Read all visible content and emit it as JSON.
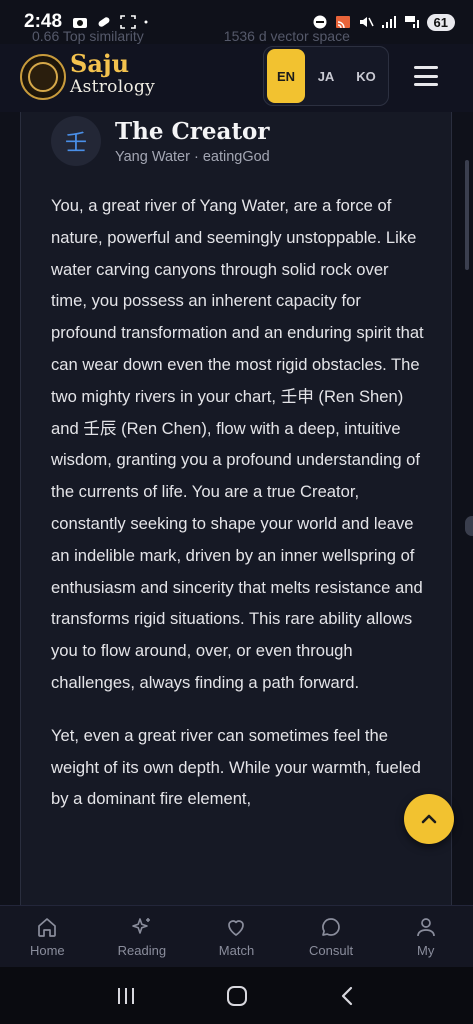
{
  "status_bar": {
    "time": "2:48",
    "battery": "61"
  },
  "ghost_row": {
    "left": "0.66 Top similarity",
    "right": "1536 d vector space"
  },
  "header": {
    "brand_line1": "Saju",
    "brand_line2": "Astrology",
    "languages": [
      {
        "code": "EN",
        "active": true
      },
      {
        "code": "JA",
        "active": false
      },
      {
        "code": "KO",
        "active": false
      }
    ]
  },
  "card": {
    "glyph": "壬",
    "title": "The Creator",
    "subtitle": "Yang Water · eatingGod",
    "paragraphs": [
      "You, a great river of Yang Water, are a force of nature, powerful and seemingly unstoppable. Like water carving canyons through solid rock over time, you possess an inherent capacity for profound transformation and an enduring spirit that can wear down even the most rigid obstacles. The two mighty rivers in your chart, 壬申 (Ren Shen) and 壬辰 (Ren Chen), flow with a deep, intuitive wisdom, granting you a profound understanding of the currents of life. You are a true Creator, constantly seeking to shape your world and leave an indelible mark, driven by an inner wellspring of enthusiasm and sincerity that melts resistance and transforms rigid situations. This rare ability allows you to flow around, over, or even through challenges, always finding a path forward.",
      "Yet, even a great river can sometimes feel the weight of its own depth. While your warmth, fueled by a dominant fire element,"
    ]
  },
  "bottom_nav": [
    {
      "label": "Home",
      "icon": "home-icon"
    },
    {
      "label": "Reading",
      "icon": "sparkle-icon"
    },
    {
      "label": "Match",
      "icon": "heart-icon"
    },
    {
      "label": "Consult",
      "icon": "chat-icon"
    },
    {
      "label": "My",
      "icon": "user-icon"
    }
  ],
  "colors": {
    "accent": "#f2c230",
    "background": "#0f111a",
    "card": "#161925"
  }
}
